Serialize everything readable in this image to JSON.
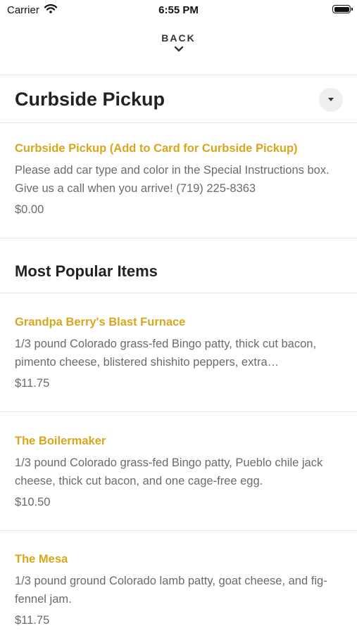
{
  "status_bar": {
    "carrier": "Carrier",
    "time": "6:55 PM"
  },
  "nav": {
    "back_label": "BACK"
  },
  "curbside": {
    "title": "Curbside Pickup",
    "item": {
      "name": "Curbside Pickup (Add to Card for Curbside Pickup)",
      "description": "Please add car type and color in the Special Instructions box. Give us a call when you arrive! (719) 225-8363",
      "price": "$0.00"
    }
  },
  "popular": {
    "title": "Most Popular Items",
    "items": [
      {
        "name": "Grandpa Berry's Blast Furnace",
        "description": "1/3 pound Colorado grass-fed Bingo patty, thick cut bacon, pimento cheese, blistered shishito peppers, extra…",
        "price": "$11.75"
      },
      {
        "name": "The Boilermaker",
        "description": "1/3 pound Colorado grass-fed Bingo patty, Pueblo chile jack cheese, thick cut bacon, and one cage-free egg.",
        "price": "$10.50"
      },
      {
        "name": "The Mesa",
        "description": "1/3 pound ground Colorado lamb patty, goat cheese, and fig-fennel jam.",
        "price": "$11.75"
      }
    ]
  },
  "colors": {
    "accent": "#d9a61c",
    "text": "#2b2b2b",
    "muted": "#6b6b6b",
    "divider": "#e6e6e6"
  }
}
